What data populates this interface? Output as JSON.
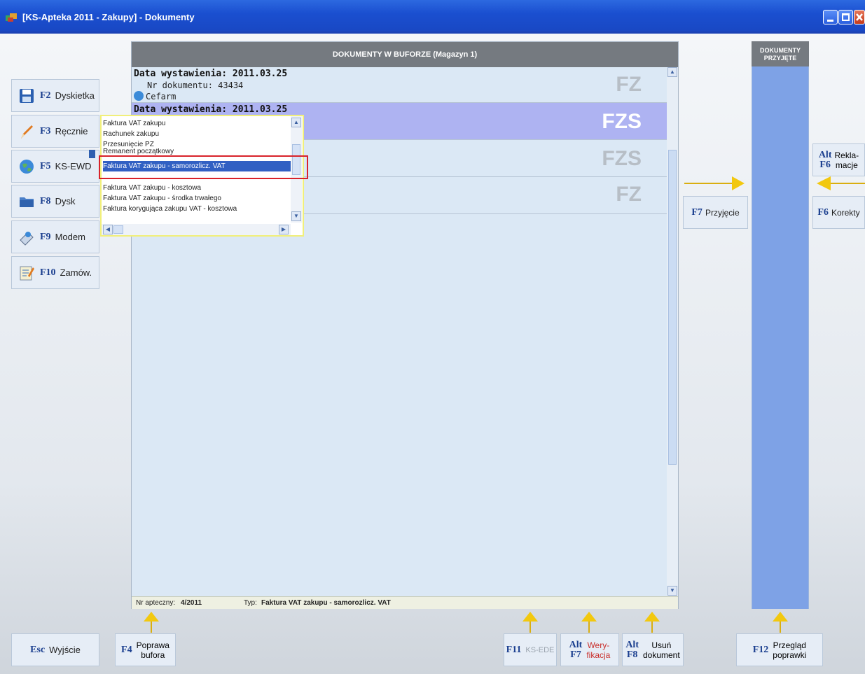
{
  "window": {
    "title": "[KS-Apteka 2011 - Zakupy] - Dokumenty"
  },
  "left_buttons": [
    {
      "key": "F2",
      "label": "Dyskietka",
      "icon": "floppy-icon"
    },
    {
      "key": "F3",
      "label": "Ręcznie",
      "icon": "pencil-icon"
    },
    {
      "key": "F5",
      "label": "KS-EWD",
      "icon": "globe-icon"
    },
    {
      "key": "F8",
      "label": "Dysk",
      "icon": "folder-icon"
    },
    {
      "key": "F9",
      "label": "Modem",
      "icon": "modem-icon"
    },
    {
      "key": "F10",
      "label": "Zamów.",
      "icon": "order-notepad-icon"
    }
  ],
  "buffer": {
    "header": "DOKUMENTY W BUFORZE (Magazyn 1)",
    "documents": [
      {
        "date": "Data wystawienia: 2011.03.25",
        "number": "Nr dokumentu: 43434",
        "supplier": "Cefarm",
        "type": "FZ",
        "selected": false
      },
      {
        "date": "Data wystawienia: 2011.03.25",
        "type": "FZS",
        "selected": true
      },
      {
        "type": "FZS",
        "selected": false
      },
      {
        "type": "FZ",
        "selected": false
      }
    ],
    "status": {
      "pharmacy_label": "Nr apteczny:",
      "pharmacy_value": "4/2011",
      "type_label": "Typ:",
      "type_value": "Faktura VAT zakupu - samorozlicz. VAT"
    }
  },
  "dropdown": {
    "items": [
      "Faktura VAT zakupu",
      "Rachunek zakupu",
      "Przesunięcie PZ",
      "Remanent początkowy",
      "Faktura VAT zakupu - samorozlicz. VAT",
      "",
      "Faktura VAT zakupu - kosztowa",
      "Faktura VAT zakupu - środka trwałego",
      "Faktura korygująca zakupu VAT - kosztowa"
    ],
    "selected_index": 4
  },
  "accepted": {
    "header_line1": "DOKUMENTY",
    "header_line2": "PRZYJĘTE"
  },
  "right_buttons": {
    "accept_key": "F7",
    "accept_label": "Przyjęcie",
    "complaints_key1": "Alt",
    "complaints_key2": "F6",
    "complaints_label1": "Rekla-",
    "complaints_label2": "macje",
    "corrections_key": "F6",
    "corrections_label": "Korekty"
  },
  "bottom_buttons": {
    "exit_key": "Esc",
    "exit_label": "Wyjście",
    "fix_key": "F4",
    "fix_label1": "Poprawa",
    "fix_label2": "bufora",
    "ksede_key": "F11",
    "ksede_label": "KS-EDE",
    "verify_key1": "Alt",
    "verify_key2": "F7",
    "verify_label1": "Wery-",
    "verify_label2": "fikacja",
    "delete_key1": "Alt",
    "delete_key2": "F8",
    "delete_label1": "Usuń",
    "delete_label2": "dokument",
    "review_key": "F12",
    "review_label1": "Przegląd",
    "review_label2": "poprawki"
  },
  "colors": {
    "title_bar": "#1a4fd0",
    "selected_row": "#aeb3f2",
    "accepted_column": "#7ea2e6",
    "arrow": "#f2c80f",
    "highlight": "#d8222a"
  }
}
